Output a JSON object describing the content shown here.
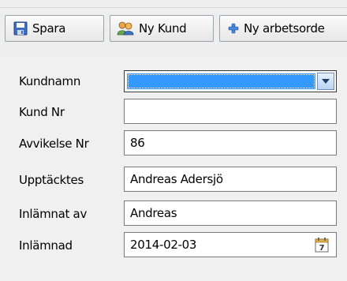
{
  "toolbar": {
    "save_label": "Spara",
    "new_customer_label": "Ny Kund",
    "new_order_label": "Ny arbetsorde"
  },
  "form": {
    "fields": [
      {
        "label": "Kundnamn",
        "value": ""
      },
      {
        "label": "Kund Nr",
        "value": ""
      },
      {
        "label": "Avvikelse Nr",
        "value": "86"
      },
      {
        "label": "Upptäcktes",
        "value": "Andreas Adersjö"
      },
      {
        "label": "Inlämnat av",
        "value": "Andreas"
      },
      {
        "label": "Inlämnad",
        "value": "2014-02-03"
      }
    ],
    "calendar_day": "7"
  },
  "icons": {
    "save": "floppy-disk-icon",
    "new_customer": "people-icon",
    "new_order": "plus-icon",
    "dropdown": "chevron-down-icon",
    "calendar": "calendar-icon"
  },
  "colors": {
    "selection": "#3399ff",
    "window_bg": "#f0f0f0"
  }
}
